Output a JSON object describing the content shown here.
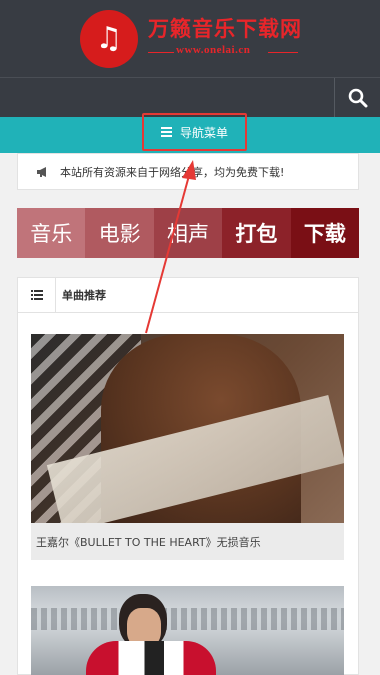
{
  "header": {
    "brand_title": "万籁音乐下载网",
    "brand_url": "www.onelai.cn"
  },
  "nav": {
    "menu_label": "导航菜单"
  },
  "notice": {
    "text": "本站所有资源来自于网络分享，均为免费下载!"
  },
  "categories": [
    {
      "label": "音乐",
      "color": "#c0747a"
    },
    {
      "label": "电影",
      "color": "#b05a60"
    },
    {
      "label": "相声",
      "color": "#9e4047"
    },
    {
      "label": "打包",
      "color": "#8c2229"
    },
    {
      "label": "下载",
      "color": "#7a0f15"
    }
  ],
  "recommend": {
    "title": "单曲推荐",
    "items": [
      {
        "caption": "王嘉尔《BULLET TO THE HEART》无损音乐"
      },
      {
        "caption": ""
      }
    ]
  },
  "colors": {
    "header_bg": "#383c43",
    "nav_bg": "#20b2b8",
    "accent_red": "#e53935"
  },
  "icons": {
    "logo": "music-note-icon",
    "search": "search-icon",
    "menu": "hamburger-icon",
    "notice": "megaphone-icon",
    "list": "list-icon"
  }
}
